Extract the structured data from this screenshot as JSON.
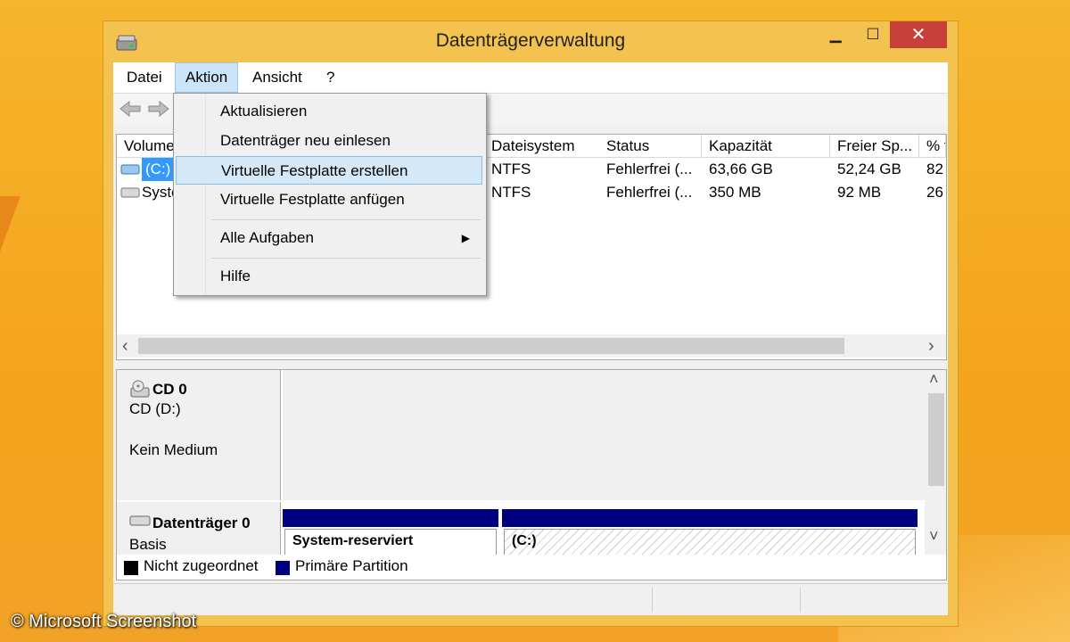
{
  "window": {
    "title": "Datenträgerverwaltung",
    "minimize": "▁",
    "maximize": "☐",
    "close": "✕"
  },
  "menubar": [
    "Datei",
    "Aktion",
    "Ansicht",
    "?"
  ],
  "dropdown": {
    "items": [
      "Aktualisieren",
      "Datenträger neu einlesen",
      "Virtuelle Festplatte erstellen",
      "Virtuelle Festplatte anfügen"
    ],
    "submenu": "Alle Aufgaben",
    "help": "Hilfe",
    "highlighted": "Virtuelle Festplatte erstellen"
  },
  "volume_list": {
    "columns": [
      "Volume",
      "Dateisystem",
      "Status",
      "Kapazität",
      "Freier Sp...",
      "% f"
    ],
    "rows": [
      {
        "volume": "(C:)",
        "filesystem": "NTFS",
        "status": "Fehlerfrei (...",
        "capacity": "63,66 GB",
        "free": "52,24 GB",
        "pct": "82"
      },
      {
        "volume": "Syste",
        "filesystem": "NTFS",
        "status": "Fehlerfrei (...",
        "capacity": "350 MB",
        "free": "92 MB",
        "pct": "26"
      }
    ],
    "scroll_left": "‹",
    "scroll_right": "›"
  },
  "disks": [
    {
      "name": "CD 0",
      "line2": "CD (D:)",
      "line3": "Kein Medium"
    },
    {
      "name": "Datenträger 0",
      "line2": "Basis",
      "partitions": [
        "System-reserviert",
        "(C:)"
      ]
    }
  ],
  "disk_scroll": {
    "up": "˄",
    "down": "˅"
  },
  "legend": [
    {
      "label": "Nicht zugeordnet",
      "color": "#000000"
    },
    {
      "label": "Primäre Partition",
      "color": "#00007f"
    }
  ],
  "colors": {
    "selection": "#3399ff",
    "menu_highlight": "#d5e8f8",
    "close_button": "#c7413a",
    "partition_header": "#00007f",
    "frame": "#f4c34f"
  },
  "watermark": "© Microsoft Screenshot"
}
